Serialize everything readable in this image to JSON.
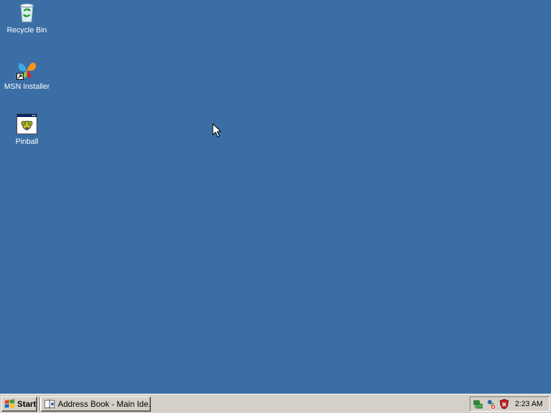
{
  "desktop": {
    "background_color": "#3a6ea5",
    "icons": [
      {
        "label": "Recycle Bin",
        "icon": "recycle-bin-icon"
      },
      {
        "label": "MSN Installer",
        "icon": "msn-butterfly-icon",
        "shortcut": true
      },
      {
        "label": "Pinball",
        "icon": "pinball-app-icon"
      }
    ]
  },
  "taskbar": {
    "start_label": "Start",
    "tasks": [
      {
        "label": "Address Book - Main Ide...",
        "icon": "address-book-icon"
      }
    ],
    "tray": {
      "icons": [
        "network-icon",
        "security-alert-icon",
        "shield-icon"
      ],
      "clock": "2:23 AM"
    }
  }
}
